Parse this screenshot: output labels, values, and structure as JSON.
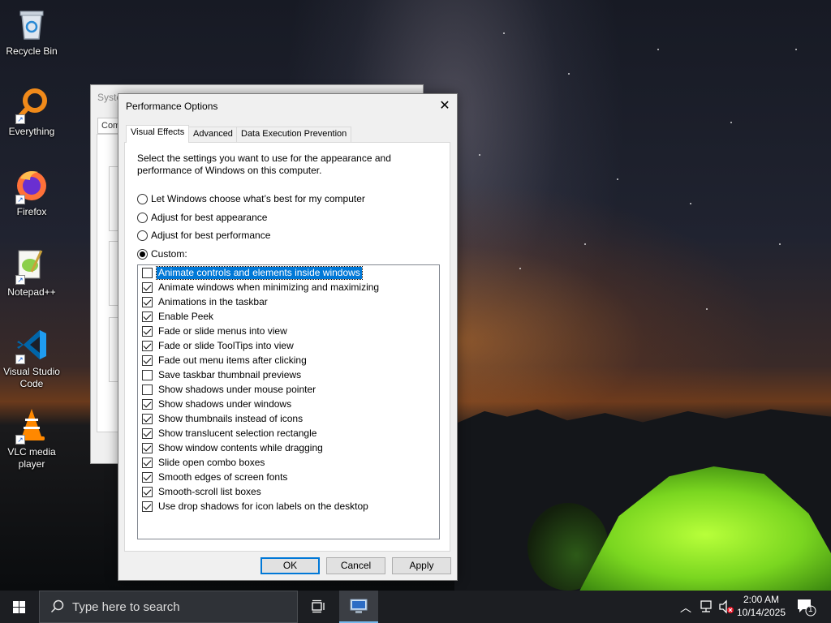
{
  "desktop": {
    "icons": [
      {
        "label": "Recycle Bin",
        "icon": "recycle-bin-icon"
      },
      {
        "label": "Everything",
        "icon": "everything-search-icon"
      },
      {
        "label": "Firefox",
        "icon": "firefox-icon"
      },
      {
        "label": "Notepad++",
        "icon": "notepad-plus-plus-icon"
      },
      {
        "label": "Visual Studio\nCode",
        "icon": "vscode-icon"
      },
      {
        "label": "VLC media\nplayer",
        "icon": "vlc-icon"
      }
    ]
  },
  "background_window": {
    "title": "Syste",
    "tab": "Com"
  },
  "dialog": {
    "title": "Performance Options",
    "close_glyph": "✕",
    "tabs": [
      "Visual Effects",
      "Advanced",
      "Data Execution Prevention"
    ],
    "active_tab": "Visual Effects",
    "description": "Select the settings you want to use for the appearance and performance of Windows on this computer.",
    "radios": [
      {
        "label": "Let Windows choose what’s best for my computer",
        "checked": false
      },
      {
        "label": "Adjust for best appearance",
        "checked": false
      },
      {
        "label": "Adjust for best performance",
        "checked": false
      },
      {
        "label": "Custom:",
        "checked": true
      }
    ],
    "effects": [
      {
        "label": "Animate controls and elements inside windows",
        "checked": false,
        "selected": true
      },
      {
        "label": "Animate windows when minimizing and maximizing",
        "checked": true
      },
      {
        "label": "Animations in the taskbar",
        "checked": true
      },
      {
        "label": "Enable Peek",
        "checked": true
      },
      {
        "label": "Fade or slide menus into view",
        "checked": true
      },
      {
        "label": "Fade or slide ToolTips into view",
        "checked": true
      },
      {
        "label": "Fade out menu items after clicking",
        "checked": true
      },
      {
        "label": "Save taskbar thumbnail previews",
        "checked": false
      },
      {
        "label": "Show shadows under mouse pointer",
        "checked": false
      },
      {
        "label": "Show shadows under windows",
        "checked": true
      },
      {
        "label": "Show thumbnails instead of icons",
        "checked": true
      },
      {
        "label": "Show translucent selection rectangle",
        "checked": true
      },
      {
        "label": "Show window contents while dragging",
        "checked": true
      },
      {
        "label": "Slide open combo boxes",
        "checked": true
      },
      {
        "label": "Smooth edges of screen fonts",
        "checked": true
      },
      {
        "label": "Smooth-scroll list boxes",
        "checked": true
      },
      {
        "label": "Use drop shadows for icon labels on the desktop",
        "checked": true
      }
    ],
    "buttons": {
      "ok": "OK",
      "cancel": "Cancel",
      "apply": "Apply"
    }
  },
  "taskbar": {
    "search_placeholder": "Type here to search",
    "time": "2:00 AM",
    "date": "10/14/2025",
    "notification_count": "1",
    "accent_color": "#0078d7"
  }
}
